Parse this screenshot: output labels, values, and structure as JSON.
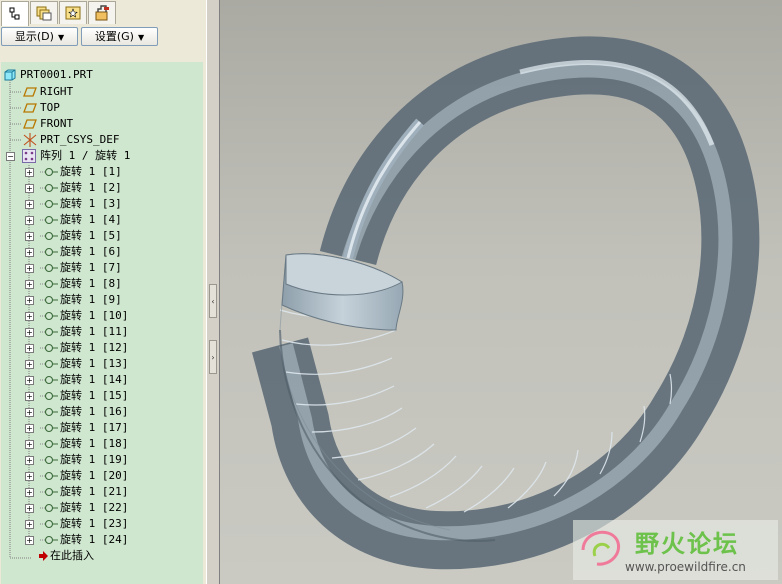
{
  "toolbar": {
    "show_label": "显示(D)",
    "settings_label": "设置(G)"
  },
  "tabs": [
    {
      "icon": "model-tree-icon",
      "active": true
    },
    {
      "icon": "folder-browser-icon",
      "active": false
    },
    {
      "icon": "favorites-icon",
      "active": false
    },
    {
      "icon": "connections-icon",
      "active": false
    }
  ],
  "tree": {
    "root": "PRT0001.PRT",
    "datums": [
      "RIGHT",
      "TOP",
      "FRONT"
    ],
    "csys": "PRT_CSYS_DEF",
    "pattern": "阵列 1 / 旋转 1",
    "features": [
      "旋转 1 [1]",
      "旋转 1 [2]",
      "旋转 1 [3]",
      "旋转 1 [4]",
      "旋转 1 [5]",
      "旋转 1 [6]",
      "旋转 1 [7]",
      "旋转 1 [8]",
      "旋转 1 [9]",
      "旋转 1 [10]",
      "旋转 1 [11]",
      "旋转 1 [12]",
      "旋转 1 [13]",
      "旋转 1 [14]",
      "旋转 1 [15]",
      "旋转 1 [16]",
      "旋转 1 [17]",
      "旋转 1 [18]",
      "旋转 1 [19]",
      "旋转 1 [20]",
      "旋转 1 [21]",
      "旋转 1 [22]",
      "旋转 1 [23]",
      "旋转 1 [24]"
    ],
    "insert_here": "在此插入"
  },
  "watermark": {
    "title": "野火论坛",
    "url": "www.proewildfire.cn"
  },
  "colors": {
    "tree_bg": "#cfe6cf",
    "viewport_top": "#aaaaa3",
    "viewport_bottom": "#cacac3",
    "model": "#9fb1bd"
  }
}
